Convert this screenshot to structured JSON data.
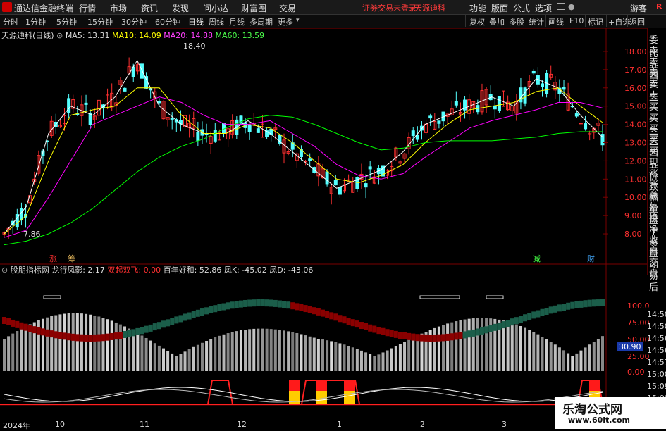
{
  "titlebar": {
    "app_name": "通达信金融终端",
    "menus": [
      "行情",
      "市场",
      "资讯",
      "发现",
      "问小达",
      "财富圈",
      "交易"
    ],
    "warning": "证券交易未登录",
    "stock_name": "天源迪科",
    "right_menus": [
      "功能",
      "版面",
      "公式",
      "选项"
    ],
    "guest": "游客",
    "r_letter": "R"
  },
  "toolbar": {
    "periods": [
      "分时",
      "1分钟",
      "5分钟",
      "15分钟",
      "30分钟",
      "60分钟",
      "日线",
      "周线",
      "月线",
      "多周期",
      "更多"
    ],
    "active_period": "日线",
    "right_items": [
      "复权",
      "叠加",
      "多股",
      "统计",
      "画线",
      "F10",
      "标记",
      "+自选",
      "返回"
    ]
  },
  "kline_header": {
    "stock": "天源迪科",
    "period": "(日线)",
    "ma5": "MA5: 13.31",
    "ma10": "MA10: 14.09",
    "ma20": "MA20: 14.88",
    "ma60": "MA60: 13.59"
  },
  "annotations": {
    "high": "18.40",
    "low": "7.86",
    "zhang": "涨",
    "chou": "筹",
    "jian": "减",
    "cai": "财"
  },
  "price_axis": [
    "18.00",
    "17.00",
    "16.00",
    "15.00",
    "14.00",
    "13.00",
    "12.00",
    "11.00",
    "10.00",
    "9.00",
    "8.00"
  ],
  "indicator_header": {
    "name": "股朋指标网",
    "l1": "龙行凤影: 2.17",
    "l2": "双起双飞: 0.00",
    "l3": "百年好和: 52.86",
    "l4": "凤K: -45.02",
    "l5": "凤D: -43.06"
  },
  "indicator_axis": [
    "100.0",
    "75.00",
    "50.00",
    "25.00",
    "0.00"
  ],
  "indicator_value": "30.90",
  "time_axis_right": [
    "14:50",
    "14:50",
    "14:56",
    "14:56",
    "14:57",
    "15:00",
    "15:09",
    "15:09"
  ],
  "right_panel": [
    "委比",
    "卖五",
    "卖四",
    "卖三",
    "卖二",
    "卖一",
    "买一",
    "买二",
    "买三",
    "买四",
    "买五",
    "现价",
    "涨跌",
    "涨幅",
    "总量",
    "外盘",
    "换手",
    "净资",
    "收益",
    "自动",
    "交易",
    "盘后"
  ],
  "date_axis": [
    "2024年",
    "10",
    "11",
    "12",
    "1",
    "2",
    "3"
  ],
  "watermark": {
    "line1": "乐淘公式网",
    "line2": "www.60lt.com"
  },
  "colors": {
    "up": "#ff3030",
    "down": "#54ffff",
    "ma5": "#ffffff",
    "ma10": "#ffff00",
    "ma20": "#ff00ff",
    "ma60": "#00ff00"
  },
  "chart_data": {
    "type": "line",
    "title": "天源迪科 (日线)",
    "ylim": [
      7.5,
      18.5
    ],
    "series": [
      {
        "name": "MA5",
        "values": [
          8.0,
          9.5,
          13.5,
          15.0,
          14.5,
          15.5,
          17.5,
          15.0,
          14.0,
          13.5,
          13.5,
          14.2,
          13.5,
          12.5,
          11.5,
          10.5,
          11.0,
          11.5,
          12.5,
          14.0,
          14.5,
          15.0,
          15.5,
          15.0,
          16.5,
          16.0,
          14.5,
          13.3
        ]
      },
      {
        "name": "MA10",
        "values": [
          8.0,
          9.0,
          12.0,
          14.5,
          14.8,
          15.0,
          16.0,
          16.0,
          14.5,
          13.5,
          13.5,
          14.0,
          13.8,
          13.0,
          12.0,
          11.0,
          10.8,
          11.2,
          11.8,
          13.0,
          14.0,
          14.8,
          15.0,
          15.2,
          15.8,
          16.0,
          15.0,
          14.1
        ]
      },
      {
        "name": "MA20",
        "values": [
          7.8,
          8.2,
          10.0,
          12.0,
          14.0,
          14.5,
          15.0,
          15.5,
          15.2,
          14.5,
          14.0,
          14.0,
          14.2,
          13.5,
          12.8,
          11.8,
          11.2,
          11.0,
          11.3,
          12.2,
          13.0,
          13.8,
          14.2,
          14.5,
          14.8,
          15.2,
          15.2,
          14.9
        ]
      },
      {
        "name": "MA60",
        "values": [
          7.4,
          7.6,
          8.0,
          8.6,
          9.4,
          10.4,
          11.4,
          12.2,
          12.8,
          13.2,
          13.8,
          14.3,
          14.5,
          14.4,
          14.0,
          13.5,
          13.0,
          12.6,
          12.7,
          13.0,
          13.1,
          13.1,
          13.1,
          13.2,
          13.3,
          13.5,
          13.6,
          13.6
        ]
      }
    ]
  }
}
